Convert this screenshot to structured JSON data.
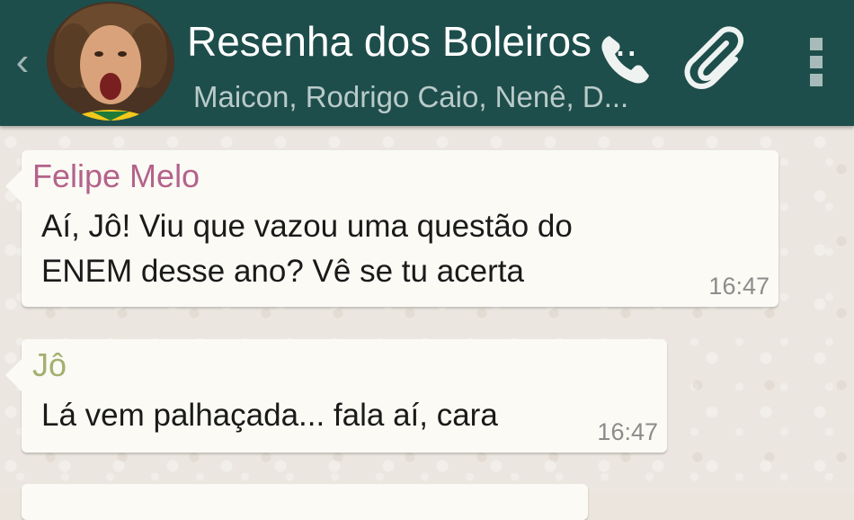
{
  "header": {
    "title": "Resenha dos Boleiros ...",
    "subtitle": "Maicon, Rodrigo Caio, Nenê, D...",
    "colors": {
      "bar": "#1e4e4c",
      "title": "#ffffff",
      "subtitle": "#b9cbc9"
    },
    "icons": [
      "back-chevron-icon",
      "group-avatar",
      "phone-icon",
      "attachment-clip-icon",
      "overflow-menu-icon"
    ]
  },
  "messages": [
    {
      "sender": "Felipe Melo",
      "sender_color": "#b4628a",
      "lines": [
        "Aí, Jô! Viu que vazou uma questão do",
        "ENEM desse ano? Vê se tu acerta"
      ],
      "time": "16:47"
    },
    {
      "sender": "Jô",
      "sender_color": "#a3b06f",
      "lines": [
        "Lá vem palhaçada... fala aí, cara"
      ],
      "time": "16:47"
    }
  ]
}
